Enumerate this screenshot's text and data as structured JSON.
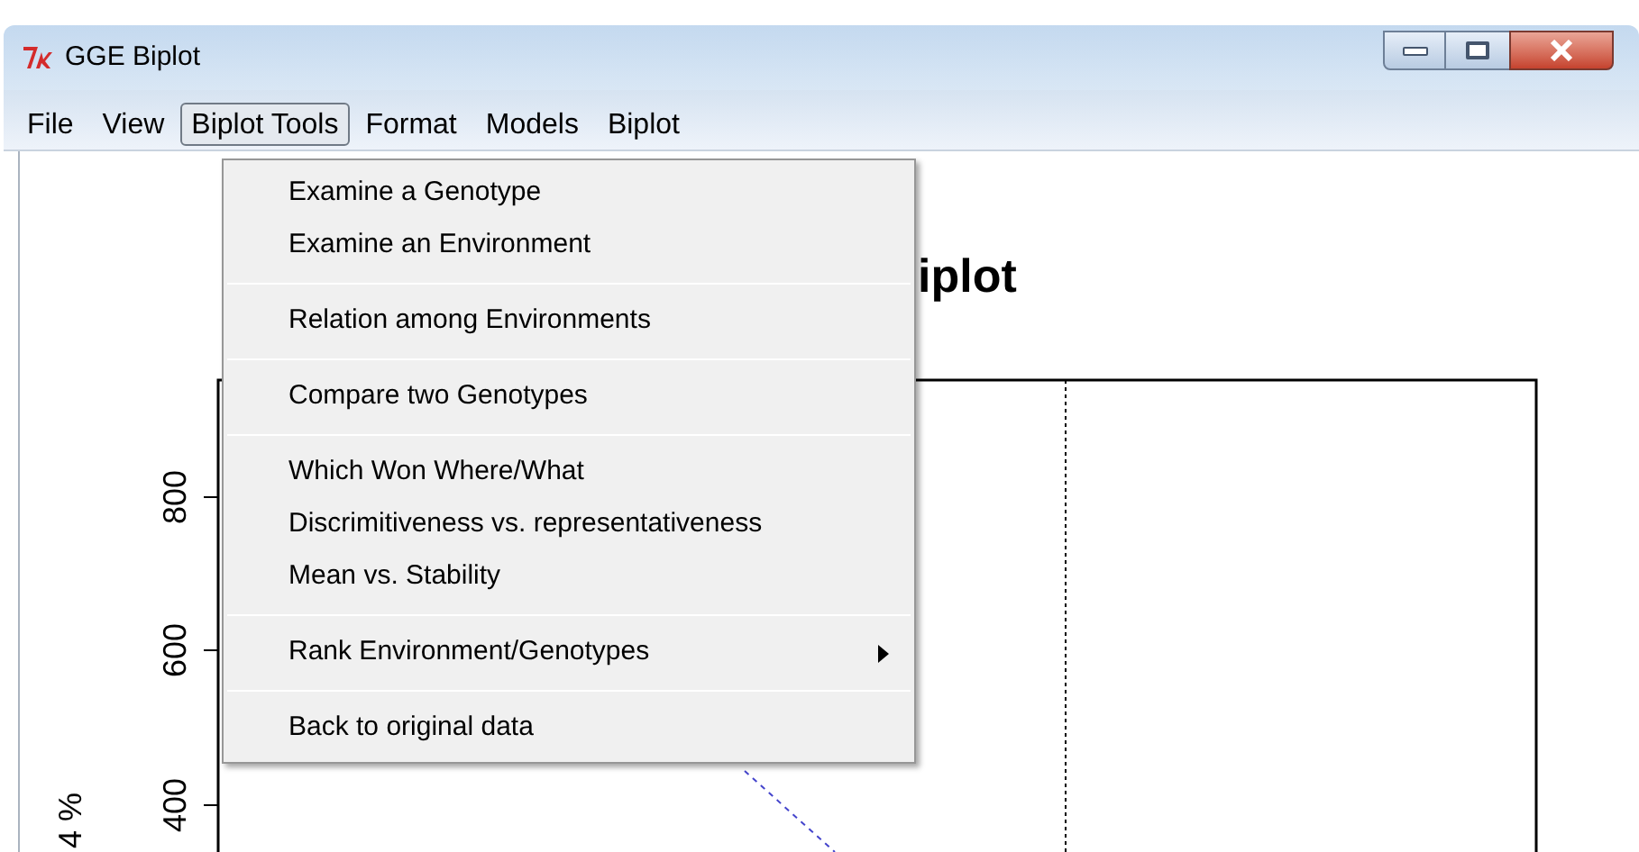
{
  "window": {
    "title": "GGE Biplot"
  },
  "menu_bar": [
    {
      "label": "File",
      "selected": false
    },
    {
      "label": "View",
      "selected": false
    },
    {
      "label": "Biplot Tools",
      "selected": true
    },
    {
      "label": "Format",
      "selected": false
    },
    {
      "label": "Models",
      "selected": false
    },
    {
      "label": "Biplot",
      "selected": false
    }
  ],
  "dropdown": [
    {
      "items": [
        {
          "label": "Examine a Genotype",
          "has_submenu": false
        },
        {
          "label": "Examine an Environment",
          "has_submenu": false
        }
      ]
    },
    {
      "items": [
        {
          "label": "Relation among Environments",
          "has_submenu": false
        }
      ]
    },
    {
      "items": [
        {
          "label": "Compare two Genotypes",
          "has_submenu": false
        }
      ]
    },
    {
      "items": [
        {
          "label": "Which Won Where/What",
          "has_submenu": false
        },
        {
          "label": "Discrimitiveness vs. representativeness",
          "has_submenu": false
        },
        {
          "label": "Mean vs. Stability",
          "has_submenu": false
        }
      ]
    },
    {
      "items": [
        {
          "label": "Rank Environment/Genotypes",
          "has_submenu": true
        }
      ]
    },
    {
      "items": [
        {
          "label": "Back to original data",
          "has_submenu": false
        }
      ]
    }
  ],
  "plot": {
    "title": "iplot",
    "y_ticks": [
      "800",
      "600",
      "400"
    ],
    "y_label": "4 %"
  }
}
